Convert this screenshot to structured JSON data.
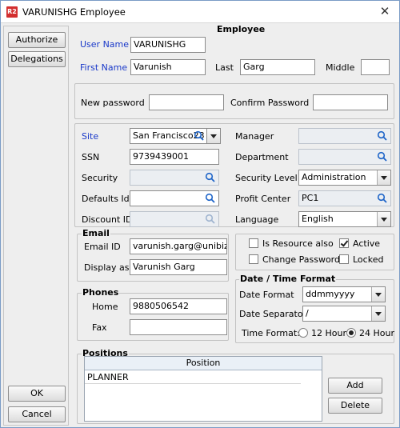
{
  "window": {
    "title": "VARUNISHG Employee",
    "app_icon": "R2"
  },
  "sidebar": {
    "authorize_label": "Authorize",
    "delegations_label": "Delegations",
    "ok_label": "OK",
    "cancel_label": "Cancel"
  },
  "form": {
    "heading": "Employee",
    "user_name": {
      "label": "User Name",
      "value": "VARUNISHG"
    },
    "first_name": {
      "label": "First Name",
      "value": "Varunish"
    },
    "last": {
      "label": "Last",
      "value": "Garg"
    },
    "middle": {
      "label": "Middle",
      "value": ""
    },
    "new_password": {
      "label": "New password",
      "value": ""
    },
    "confirm_password": {
      "label": "Confirm Password",
      "value": ""
    },
    "site": {
      "label": "Site",
      "value": "San Francisco23"
    },
    "ssn": {
      "label": "SSN",
      "value": "9739439001"
    },
    "security": {
      "label": "Security",
      "value": ""
    },
    "defaults_id": {
      "label": "Defaults Id",
      "value": ""
    },
    "discount_id": {
      "label": "Discount ID",
      "value": ""
    },
    "manager": {
      "label": "Manager",
      "value": ""
    },
    "department": {
      "label": "Department",
      "value": ""
    },
    "security_level": {
      "label": "Security Level",
      "value": "Administration"
    },
    "profit_center": {
      "label": "Profit  Center",
      "value": "PC1"
    },
    "language": {
      "label": "Language",
      "value": "English"
    }
  },
  "email": {
    "title": "Email",
    "email_id": {
      "label": "Email ID",
      "value": "varunish.garg@unibiz.co"
    },
    "display_as": {
      "label": "Display as",
      "value": "Varunish Garg"
    }
  },
  "phones": {
    "title": "Phones",
    "home": {
      "label": "Home",
      "value": "9880506542"
    },
    "fax": {
      "label": "Fax",
      "value": ""
    }
  },
  "flags": {
    "is_resource_also": {
      "label": "Is Resource also",
      "checked": false
    },
    "active": {
      "label": "Active",
      "checked": true
    },
    "change_password": {
      "label": "Change  Password",
      "checked": false
    },
    "locked": {
      "label": "Locked",
      "checked": false
    }
  },
  "datetime": {
    "title": "Date / Time Format",
    "date_format": {
      "label": "Date Format",
      "value": "ddmmyyyy"
    },
    "date_separator": {
      "label": "Date Separator",
      "value": "/"
    },
    "time_format": {
      "label": "Time Format:",
      "opt12": "12 Hour",
      "opt24": "24 Hour",
      "selected": "24 Hour"
    }
  },
  "positions": {
    "title": "Positions",
    "column": "Position",
    "rows": [
      "PLANNER"
    ],
    "add_label": "Add",
    "delete_label": "Delete"
  },
  "icons": {
    "lookup": "magnifier-icon",
    "dropdown": "chevron-down-icon",
    "close": "close-icon"
  },
  "colors": {
    "label_blue": "#1a39c9",
    "magnifier_blue": "#1e64c8",
    "app_icon_red": "#d32f2f"
  }
}
